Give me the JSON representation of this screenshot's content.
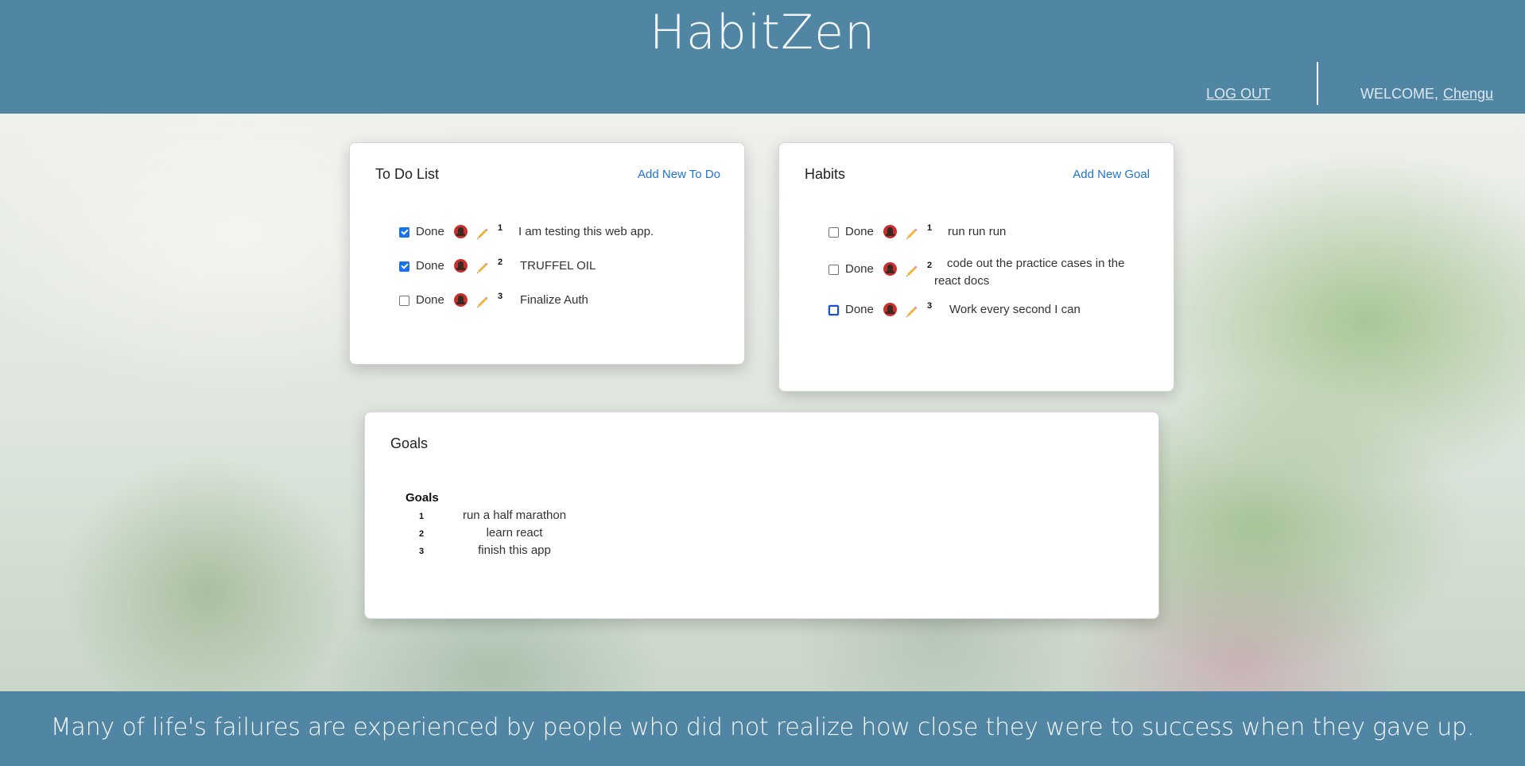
{
  "header": {
    "app_title": "HabitZen",
    "logout_label": "LOG OUT",
    "welcome_label": "WELCOME,",
    "username": "Chengu"
  },
  "todo": {
    "title": "To Do List",
    "add_label": "Add New To Do",
    "done_label": "Done",
    "items": [
      {
        "number": "1",
        "text": "I am testing this web app.",
        "checked": true
      },
      {
        "number": "2",
        "text": "TRUFFEL OIL",
        "checked": true
      },
      {
        "number": "3",
        "text": "Finalize Auth",
        "checked": false
      }
    ]
  },
  "habits": {
    "title": "Habits",
    "add_label": "Add New Goal",
    "done_label": "Done",
    "items": [
      {
        "number": "1",
        "text": "run run run",
        "checked": false
      },
      {
        "number": "2",
        "text": "code out the practice cases in the react docs",
        "checked": false
      },
      {
        "number": "3",
        "text": "Work every second I can",
        "checked": false,
        "focused": true
      }
    ]
  },
  "goals": {
    "title": "Goals",
    "column_header": "Goals",
    "items": [
      {
        "number": "1",
        "text": "run a half marathon"
      },
      {
        "number": "2",
        "text": "learn react"
      },
      {
        "number": "3",
        "text": "finish this app"
      }
    ]
  },
  "footer": {
    "quote": "Many of life's failures are experienced by people who did not realize how close they were to success when they gave up."
  },
  "colors": {
    "header_bg": "#5185a4",
    "link": "#1e74d6",
    "checkbox_checked": "#1a73e8"
  },
  "icons": {
    "delete": "delete-icon",
    "edit": "pencil-icon"
  }
}
